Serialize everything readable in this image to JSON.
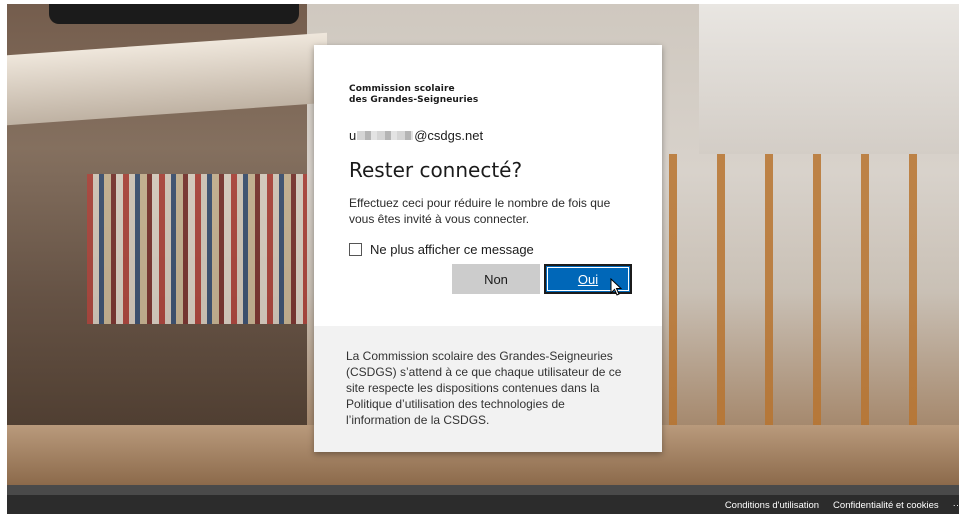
{
  "org": {
    "line1": "Commission scolaire",
    "line2": "des Grandes-Seigneuries"
  },
  "account": {
    "prefix": "u",
    "suffix": "@csdgs.net"
  },
  "dialog": {
    "title": "Rester connecté?",
    "description": "Effectuez ceci pour réduire le nombre de fois que vous êtes invité à vous connecter.",
    "checkbox_label": "Ne plus afficher ce message",
    "checkbox_checked": false,
    "no_label": "Non",
    "yes_label": "Oui"
  },
  "notice": "La Commission scolaire des Grandes-Seigneuries (CSDGS) s’attend à ce que chaque utilisateur de ce site respecte les dispositions contenues dans la Politique d’utilisation des technologies de l’information de la CSDGS.",
  "footer": {
    "terms": "Conditions d'utilisation",
    "privacy": "Confidentialité et cookies",
    "more": "··"
  },
  "colors": {
    "primary": "#0067b8",
    "secondary_button": "#cccccc",
    "footer_bg": "#2c2c2c"
  }
}
